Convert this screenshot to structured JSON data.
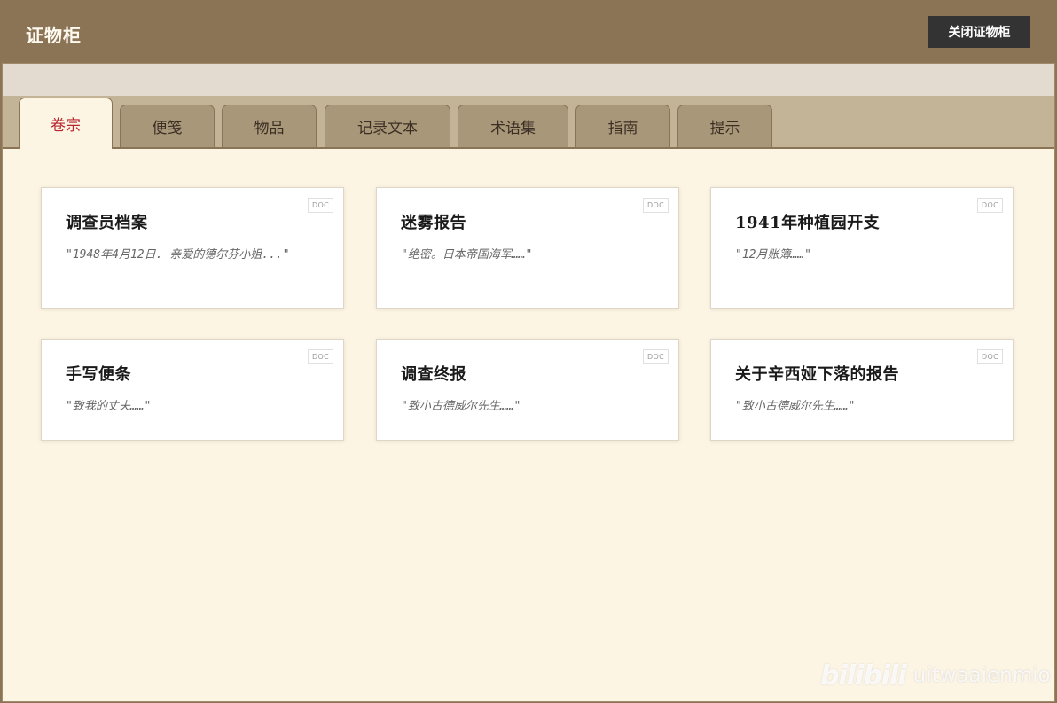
{
  "header": {
    "title": "证物柜",
    "close_label": "关闭证物柜"
  },
  "tabs": [
    {
      "label": "卷宗",
      "active": true
    },
    {
      "label": "便笺",
      "active": false
    },
    {
      "label": "物品",
      "active": false
    },
    {
      "label": "记录文本",
      "active": false
    },
    {
      "label": "术语集",
      "active": false
    },
    {
      "label": "指南",
      "active": false
    },
    {
      "label": "提示",
      "active": false
    }
  ],
  "cards": [
    {
      "title": "调查员档案",
      "snippet": "\"1948年4月12日. 亲爱的德尔芬小姐...\"",
      "badge": "DOC"
    },
    {
      "title": "迷雾报告",
      "snippet": "\"绝密。日本帝国海军……\"",
      "badge": "DOC"
    },
    {
      "title": "1941年种植园开支",
      "snippet": "\"12月账簿……\"",
      "badge": "DOC"
    },
    {
      "title": "手写便条",
      "snippet": "\"致我的丈夫……\"",
      "badge": "DOC"
    },
    {
      "title": "调查终报",
      "snippet": "\"致小古德威尔先生……\"",
      "badge": "DOC"
    },
    {
      "title": "关于辛西娅下落的报告",
      "snippet": "\"致小古德威尔先生……\"",
      "badge": "DOC"
    }
  ],
  "watermark": {
    "logo": "bilibili",
    "user": "uitwaaienmio"
  },
  "colors": {
    "header_bg": "#8b7355",
    "content_bg": "#fdf5e4",
    "tab_bg": "#a99779",
    "active_tab_text": "#b8242e",
    "close_button_bg": "#333333"
  }
}
